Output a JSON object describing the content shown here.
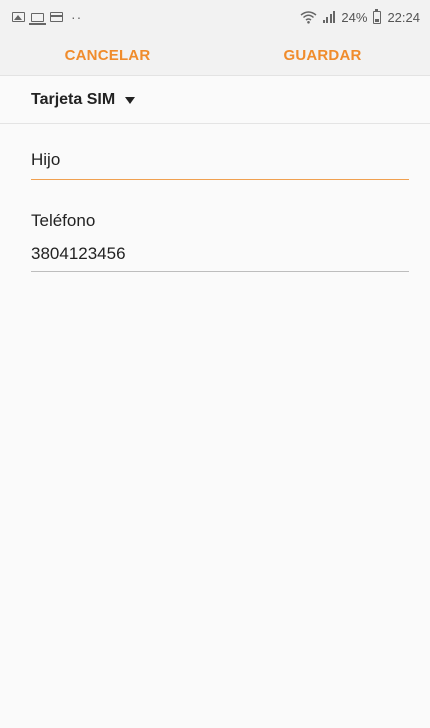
{
  "status_bar": {
    "dots": "··",
    "battery_percent": "24%",
    "time": "22:24",
    "icons": [
      "image-icon",
      "laptop-icon",
      "screen-icon",
      "wifi-icon",
      "signal-icon",
      "battery-icon"
    ]
  },
  "action_bar": {
    "cancel_label": "CANCELAR",
    "save_label": "GUARDAR",
    "accent_color": "#f08c2c"
  },
  "sim": {
    "label": "Tarjeta SIM"
  },
  "form": {
    "name_value": "Hijo",
    "phone_label": "Teléfono",
    "phone_value": "3804123456"
  }
}
